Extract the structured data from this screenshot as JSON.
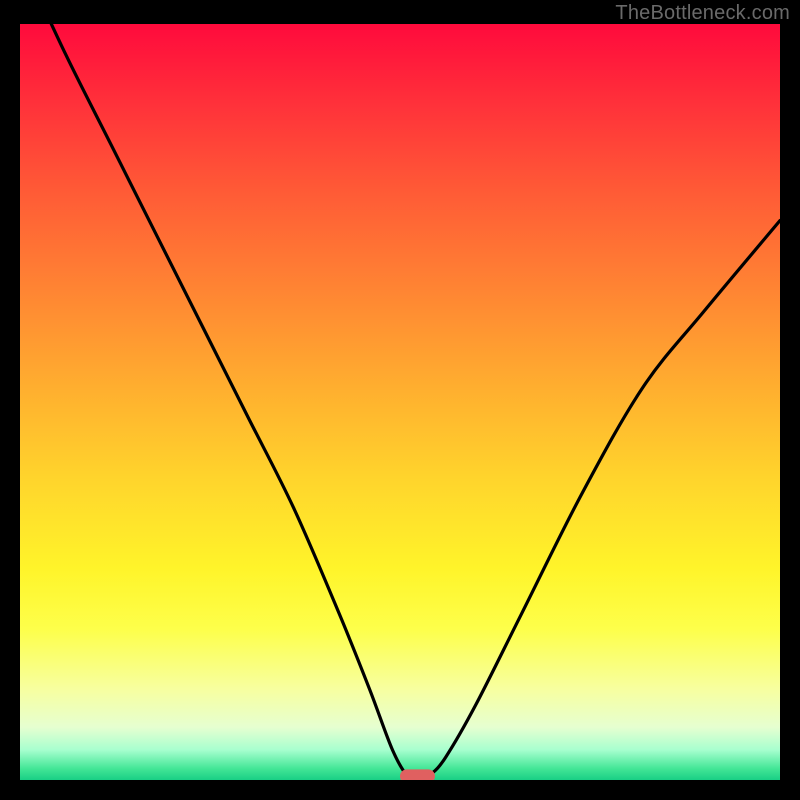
{
  "watermark": "TheBottleneck.com",
  "chart_data": {
    "type": "line",
    "title": "",
    "xlabel": "",
    "ylabel": "",
    "xlim": [
      0,
      100
    ],
    "ylim": [
      0,
      100
    ],
    "grid": false,
    "legend": false,
    "series": [
      {
        "name": "bottleneck-curve",
        "x": [
          0,
          6,
          12,
          18,
          24,
          30,
          36,
          42,
          46,
          49,
          51,
          52.5,
          54,
          56,
          60,
          66,
          74,
          82,
          90,
          100
        ],
        "y": [
          109,
          96,
          84,
          72,
          60,
          48,
          36,
          22,
          12,
          4,
          0.5,
          0,
          0.7,
          3,
          10,
          22,
          38,
          52,
          62,
          74
        ]
      }
    ],
    "marker": {
      "x_center": 52.3,
      "y": 0.5,
      "width": 4.6,
      "height": 1.8
    },
    "background_gradient": {
      "stops": [
        {
          "pos": 0.0,
          "color": "#ff0a3c"
        },
        {
          "pos": 0.1,
          "color": "#ff2f3a"
        },
        {
          "pos": 0.22,
          "color": "#ff5a36"
        },
        {
          "pos": 0.35,
          "color": "#ff8433"
        },
        {
          "pos": 0.48,
          "color": "#ffae2f"
        },
        {
          "pos": 0.6,
          "color": "#ffd42c"
        },
        {
          "pos": 0.72,
          "color": "#fff42a"
        },
        {
          "pos": 0.8,
          "color": "#fdff4a"
        },
        {
          "pos": 0.88,
          "color": "#f7ffa0"
        },
        {
          "pos": 0.93,
          "color": "#e6ffd0"
        },
        {
          "pos": 0.96,
          "color": "#a8ffcf"
        },
        {
          "pos": 0.985,
          "color": "#43e696"
        },
        {
          "pos": 1.0,
          "color": "#19cf85"
        }
      ]
    }
  }
}
